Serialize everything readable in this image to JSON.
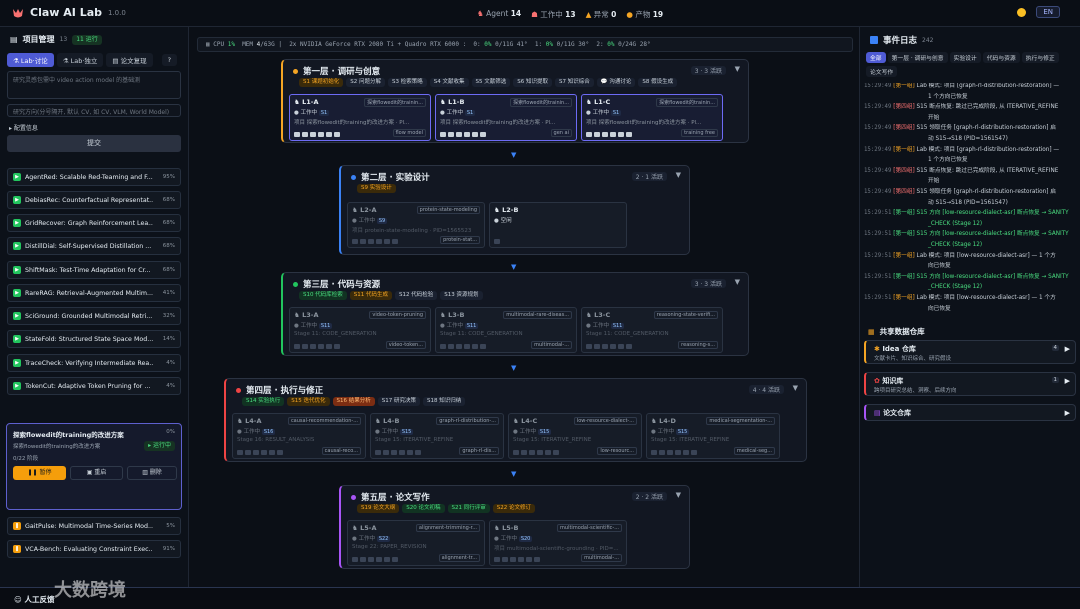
{
  "app": {
    "title": "Claw AI Lab",
    "version": "1.0.0",
    "lang": "EN"
  },
  "stats": [
    {
      "label": "Agent",
      "value": "14"
    },
    {
      "label": "工作中",
      "value": "13"
    },
    {
      "label": "异常",
      "value": "0"
    },
    {
      "label": "产物",
      "value": "19"
    }
  ],
  "project": {
    "title": "项目管理",
    "count": "13",
    "running": "11 运行",
    "help": "?",
    "tabs": [
      "Lab·讨论",
      "Lab·独立",
      "论文复现"
    ],
    "input_placeholder": "研究灵感包需中 video action model 的基础测",
    "direction_placeholder": "研究方向(分号隔开, 默认 CV, 如 CV, VLM, World Model)",
    "config_label": "▸ 配置信息",
    "submit": "提交"
  },
  "projects": [
    {
      "name": "AgentRed: Scalable Red-Teaming and F...",
      "pct": "95%"
    },
    {
      "name": "DebiasRec: Counterfactual Representat...",
      "pct": "68%"
    },
    {
      "name": "GridRecover: Graph Reinforcement Lea...",
      "pct": "68%"
    },
    {
      "name": "DistillDial: Self-Supervised Distillation ...",
      "pct": "68%"
    },
    {
      "name": "ShiftMask: Test-Time Adaptation for Cr...",
      "pct": "68%"
    },
    {
      "name": "RareRAG: Retrieval-Augmented Multim...",
      "pct": "41%"
    },
    {
      "name": "SciGround: Grounded Multimodal Retri...",
      "pct": "32%"
    },
    {
      "name": "StateFold: Structured State Space Mod...",
      "pct": "14%"
    },
    {
      "name": "TraceCheck: Verifying Intermediate Rea...",
      "pct": "4%"
    },
    {
      "name": "TokenCut: Adaptive Token Pruning for ...",
      "pct": "4%"
    }
  ],
  "active_project": {
    "name": "探索flowedit的training的改进方案",
    "pct": "0%",
    "desc": "探索flowedit的training的改进方案",
    "status": "▸ 运行中",
    "progress": "0/22 阶段",
    "buttons": [
      "暂停",
      "重启",
      "删除"
    ]
  },
  "projects_bottom": [
    {
      "name": "GaitPulse: Multimodal Time-Series Mod...",
      "pct": "5%"
    },
    {
      "name": "VCA-Bench: Evaluating Constraint Exec...",
      "pct": "91%"
    }
  ],
  "resource": {
    "cpu_label": "CPU",
    "cpu": "1%",
    "mem_label": "MEM",
    "mem": "4",
    "mem_total": "/63G",
    "gpu": "2x NVIDIA GeForce RTX 2080 Ti + Quadro RTX 6000",
    "g0": "0:",
    "g0v": "0%",
    "g0m": "0/11G 41°",
    "g1": "1:",
    "g1v": "0%",
    "g1m": "0/11G 30°",
    "g2": "2:",
    "g2v": "0%",
    "g2m": "0/24G 28°"
  },
  "layers": [
    {
      "title": "第一层 · 调研与创意",
      "badge": "3 · 3 活跃",
      "color": "#f5a524",
      "stages": [
        "S1 课题初始化",
        "S2 问题分解",
        "S3 检索策略",
        "S4 文献收集",
        "S5 文献筛选",
        "S6 知识提取",
        "S7 知识综合",
        "💬 沟通讨论",
        "S8 假设生成"
      ],
      "cards": [
        {
          "id": "L1-A",
          "tag": "探索flowedit的trainin...",
          "status": "工作中",
          "num": "S1",
          "desc": "项目 探索flowedit的training的改进方案 · Pl...",
          "mod": "flow model"
        },
        {
          "id": "L1-B",
          "tag": "探索flowedit的trainin...",
          "status": "工作中",
          "num": "S1",
          "desc": "项目 探索flowedit的training的改进方案 · Pl...",
          "mod": "gen ai"
        },
        {
          "id": "L1-C",
          "tag": "探索flowedit的trainin...",
          "status": "工作中",
          "num": "S1",
          "desc": "项目 探索flowedit的training的改进方案 · Pl...",
          "mod": "training free"
        }
      ]
    },
    {
      "title": "第二层 · 实验设计",
      "badge": "2 · 1 活跃",
      "color": "#3b82f6",
      "stages": [
        "S9 实验设计"
      ],
      "cards": [
        {
          "id": "L2-A",
          "tag": "protein-state-modeling",
          "status": "工作中",
          "num": "S9",
          "desc": "项目 protein-state-modeling · PID=1565523",
          "mod": "protein-stat..."
        },
        {
          "id": "L2-B",
          "tag": "",
          "status": "空闲",
          "num": "",
          "desc": "",
          "mod": ""
        }
      ]
    },
    {
      "title": "第三层 · 代码与资源",
      "badge": "3 · 3 活跃",
      "color": "#22c55e",
      "stages": [
        "S10 代码库检索",
        "S11 代码生成",
        "S12 代码检验",
        "S13 资源规划"
      ],
      "cards": [
        {
          "id": "L3-A",
          "tag": "video-token-pruning",
          "status": "工作中",
          "num": "S11",
          "desc": "Stage 11: CODE_GENERATION",
          "mod": "video-token..."
        },
        {
          "id": "L3-B",
          "tag": "multimodal-rare-diseas...",
          "status": "工作中",
          "num": "S11",
          "desc": "Stage 11: CODE_GENERATION",
          "mod": "multimodal-..."
        },
        {
          "id": "L3-C",
          "tag": "reasoning-state-verifi...",
          "status": "工作中",
          "num": "S11",
          "desc": "Stage 11: CODE_GENERATION",
          "mod": "reasoning-s..."
        }
      ]
    },
    {
      "title": "第四层 · 执行与修正",
      "badge": "4 · 4 活跃",
      "color": "#ef4444",
      "stages": [
        "S14 实验执行",
        "S15 迭代优化",
        "S16 结果分析",
        "S17 研究决策",
        "S18 知识归纳"
      ],
      "cards": [
        {
          "id": "L4-A",
          "tag": "causal-recommendation-...",
          "status": "工作中",
          "num": "S16",
          "desc": "Stage 16: RESULT_ANALYSIS",
          "mod": "causal-reco..."
        },
        {
          "id": "L4-B",
          "tag": "graph-rl-distribution-...",
          "status": "工作中",
          "num": "S15",
          "desc": "Stage 15: ITERATIVE_REFINE",
          "mod": "graph-rl-dis..."
        },
        {
          "id": "L4-C",
          "tag": "low-resource-dialect-...",
          "status": "工作中",
          "num": "S15",
          "desc": "Stage 15: ITERATIVE_REFINE",
          "mod": "low-resourc..."
        },
        {
          "id": "L4-D",
          "tag": "medical-segmentation-...",
          "status": "工作中",
          "num": "S15",
          "desc": "Stage 15: ITERATIVE_REFINE",
          "mod": "medical-seg..."
        }
      ]
    },
    {
      "title": "第五层 · 论文写作",
      "badge": "2 · 2 活跃",
      "color": "#a855f7",
      "stages": [
        "S19 论文大纲",
        "S20 论文初稿",
        "S21 同行评审",
        "S22 论文修订"
      ],
      "cards": [
        {
          "id": "L5-A",
          "tag": "alignment-trimming-r...",
          "status": "工作中",
          "num": "S22",
          "desc": "Stage 22: PAPER_REVISION",
          "mod": "alignment-tr..."
        },
        {
          "id": "L5-B",
          "tag": "multimodal-scientific-...",
          "status": "工作中",
          "num": "S20",
          "desc": "项目 multimodal-scientific-grounding · PID=...",
          "mod": "multimodal-..."
        }
      ]
    }
  ],
  "events": {
    "title": "事件日志",
    "count": "242",
    "filters": [
      "全部",
      "第一层 · 调研与创意",
      "实验设计",
      "代码与资源",
      "执行与修正",
      "论文写作"
    ],
    "lines": [
      {
        "t": "15:29:49",
        "tag": "[第一组]",
        "c": "y",
        "msg": "Lab 模式: 项目 [graph-rl-distribution-restoration] —"
      },
      {
        "t": "",
        "tag": "",
        "c": "",
        "msg": "1 个方向已恢复"
      },
      {
        "t": "15:29:49",
        "tag": "[第四组]",
        "c": "r",
        "msg": "S15  断点恢复: 跳过已完成阶段, 从 ITERATIVE_REFINE"
      },
      {
        "t": "",
        "tag": "",
        "c": "",
        "msg": "开始"
      },
      {
        "t": "15:29:49",
        "tag": "[第四组]",
        "c": "r",
        "msg": "S15  领取任务 [graph-rl-distribution-restoration] 启"
      },
      {
        "t": "",
        "tag": "",
        "c": "",
        "msg": "动 S15→S18 (PID=1561547)"
      },
      {
        "t": "15:29:49",
        "tag": "[第一组]",
        "c": "y",
        "msg": "Lab 模式: 项目 [graph-rl-distribution-restoration] —"
      },
      {
        "t": "",
        "tag": "",
        "c": "",
        "msg": "1 个方向已恢复"
      },
      {
        "t": "15:29:49",
        "tag": "[第四组]",
        "c": "r",
        "msg": "S15  断点恢复: 跳过已完成阶段, 从 ITERATIVE_REFINE"
      },
      {
        "t": "",
        "tag": "",
        "c": "",
        "msg": "开始"
      },
      {
        "t": "15:29:49",
        "tag": "[第四组]",
        "c": "r",
        "msg": "S15  领取任务 [graph-rl-distribution-restoration] 启"
      },
      {
        "t": "",
        "tag": "",
        "c": "",
        "msg": "动 S15→S18 (PID=1561547)"
      },
      {
        "t": "15:29:51",
        "tag": "[第一组]",
        "c": "g",
        "msg": "S15  方向 [low-resource-dialect-asr] 断点恢复 → SANITY"
      },
      {
        "t": "",
        "tag": "",
        "c": "g",
        "msg": "_CHECK (Stage 12)"
      },
      {
        "t": "15:29:51",
        "tag": "[第一组]",
        "c": "g",
        "msg": "S15  方向 [low-resource-dialect-asr] 断点恢复 → SANITY"
      },
      {
        "t": "",
        "tag": "",
        "c": "g",
        "msg": "_CHECK (Stage 12)"
      },
      {
        "t": "15:29:51",
        "tag": "[第一组]",
        "c": "y",
        "msg": "Lab 模式: 项目 [low-resource-dialect-asr] — 1 个方"
      },
      {
        "t": "",
        "tag": "",
        "c": "",
        "msg": "向已恢复"
      },
      {
        "t": "15:29:51",
        "tag": "[第一组]",
        "c": "g",
        "msg": "S15  方向 [low-resource-dialect-asr] 断点恢复 → SANITY"
      },
      {
        "t": "",
        "tag": "",
        "c": "g",
        "msg": "_CHECK (Stage 12)"
      },
      {
        "t": "15:29:51",
        "tag": "[第一组]",
        "c": "y",
        "msg": "Lab 模式: 项目 [low-resource-dialect-asr] — 1 个方"
      },
      {
        "t": "",
        "tag": "",
        "c": "",
        "msg": "向已恢复"
      }
    ]
  },
  "repos": {
    "title": "共享数据仓库",
    "items": [
      {
        "title": "Idea 仓库",
        "desc": "文献卡片、知识综合、研究假设",
        "count": "4"
      },
      {
        "title": "知识库",
        "desc": "跨项目研究总结、洞察、后续方向",
        "count": "1"
      },
      {
        "title": "论文仓库",
        "desc": "",
        "count": ""
      }
    ]
  },
  "footer": {
    "feedback": "人工反馈",
    "watermark": "大数跨境"
  }
}
